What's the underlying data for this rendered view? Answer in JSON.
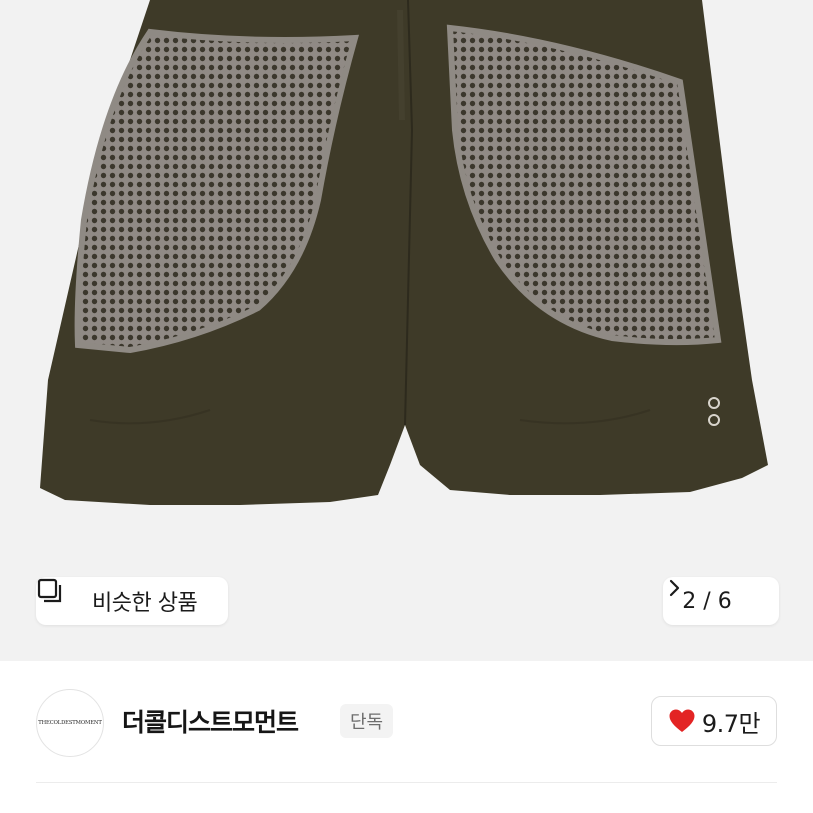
{
  "product_image": {
    "similar_button": {
      "label": "비슷한 상품",
      "icon": "similar-items-icon"
    },
    "pager": {
      "text": "2 / 6",
      "icon": "chevron-right-icon"
    }
  },
  "brand": {
    "logo_text": "THECOLDESTMOMENT",
    "name": "더콜디스트모먼트",
    "badge": "단독",
    "likes": {
      "count": "9.7만",
      "icon": "heart-icon",
      "color": "#e32424"
    }
  },
  "colors": {
    "fabric": "#3e3a28",
    "mesh": "#8a8580",
    "background": "#f2f2f2"
  }
}
